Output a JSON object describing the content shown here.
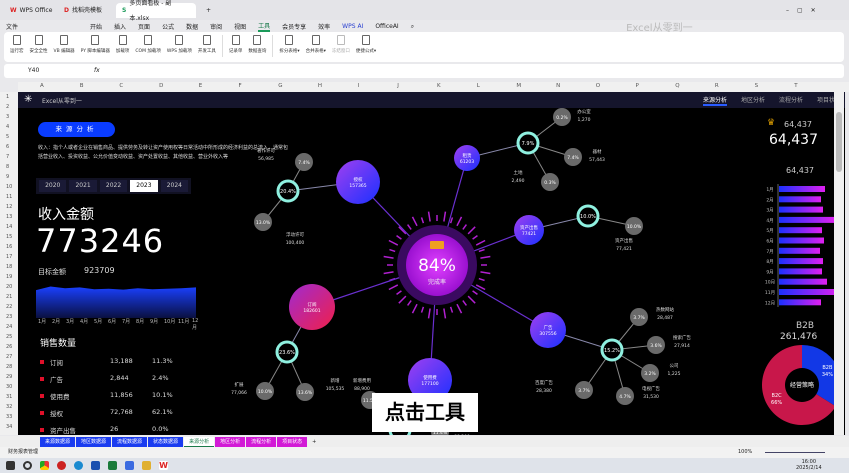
{
  "window": {
    "tabs": [
      "WPS Office",
      "找稻壳模板",
      "多页面看板 - 副本.xlsx"
    ],
    "brand_watermark": "Excel从零到一",
    "user_badge": "会"
  },
  "menu": [
    "文件",
    "开始",
    "插入",
    "页面",
    "公式",
    "数据",
    "审阅",
    "视图",
    "工具",
    "会员专享",
    "效率",
    "WPS AI",
    "OfficeAI"
  ],
  "ribbon": [
    "运行宏",
    "安全全性",
    "VB 编辑器",
    "PY 脚本编辑器",
    "加载项",
    "COM 加载项",
    "WPS 加载项",
    "开发工具",
    "记录单",
    "数据查询",
    "拆分表格▾",
    "合并表格▾",
    "冻结窗口",
    "便捷公式▾"
  ],
  "formula_bar": {
    "cell_ref": "Y40",
    "fx": "fx",
    "value": ""
  },
  "columns": [
    "A",
    "B",
    "C",
    "D",
    "E",
    "F",
    "G",
    "H",
    "I",
    "J",
    "K",
    "L",
    "M",
    "N",
    "O",
    "P",
    "Q",
    "R",
    "S",
    "T"
  ],
  "rows": [
    "1",
    "2",
    "3",
    "4",
    "5",
    "6",
    "7",
    "8",
    "9",
    "10",
    "11",
    "12",
    "13",
    "14",
    "15",
    "16",
    "17",
    "18",
    "19",
    "20",
    "21",
    "22",
    "23",
    "24",
    "25",
    "26",
    "27",
    "28",
    "29",
    "30",
    "31",
    "32",
    "33",
    "34"
  ],
  "dashboard": {
    "brand": "Excel从零到一",
    "nav": [
      "来源分析",
      "地区分析",
      "流程分析",
      "项目状态"
    ],
    "section_pill": "来源分析",
    "description": "收入：指个人或者企业在销售商品、提供劳务及转让资产使用权等日常活动中所形成的经济利益的总流入，通常包括营业收入、投资收益、公允价值变动收益、资产处置收益、其他收益、营业外收入等",
    "years": [
      "2020",
      "2021",
      "2022",
      "2023",
      "2024"
    ],
    "selected_year": "2023",
    "revenue_label": "收入金额",
    "revenue_value": "773246",
    "target_label": "目标金额",
    "target_value": "923709",
    "months": [
      "1月",
      "2月",
      "3月",
      "4月",
      "5月",
      "6月",
      "7月",
      "8月",
      "9月",
      "10月",
      "11月",
      "12月"
    ],
    "area_values": [
      62,
      70,
      66,
      68,
      64,
      65,
      63,
      66,
      64,
      65,
      66,
      68
    ],
    "sales_title": "销售数量",
    "sales": [
      [
        "订阅",
        "13,188",
        "11.3%"
      ],
      [
        "广告",
        "2,844",
        "2.4%"
      ],
      [
        "使用费",
        "11,856",
        "10.1%"
      ],
      [
        "授权",
        "72,768",
        "62.1%"
      ],
      [
        "资产出售",
        "26",
        "0.0%"
      ]
    ],
    "center": {
      "value": "84%",
      "label": "完成率"
    },
    "hubs": [
      {
        "name": "授权",
        "value": "157365",
        "ring": "20.4%",
        "leaves": [
          [
            "著作许可",
            "56,985",
            "7.4%"
          ],
          [
            "浮动许可",
            "100,400",
            "13.0%"
          ]
        ]
      },
      {
        "name": "租赁",
        "value": "61203",
        "ring": "7.9%",
        "leaves": [
          [
            "办公室",
            "1,270",
            "0.2%"
          ],
          [
            "器材",
            "57,443",
            "7.4%"
          ],
          [
            "土地",
            "2,490",
            "0.3%"
          ]
        ]
      },
      {
        "name": "资产出售",
        "value": "77421",
        "ring": "10.0%",
        "leaves": [
          [
            "资产出售",
            "77,421",
            "10.0%"
          ]
        ]
      },
      {
        "name": "订阅",
        "value": "182601",
        "ring": "23.6%",
        "leaves": [
          [
            "扩展",
            "77,066",
            "10.0%"
          ],
          [
            "新增",
            "105,535",
            "13.6%"
          ]
        ]
      },
      {
        "name": "使用费",
        "value": "177100",
        "ring": "22.0%",
        "leaves": [
          [
            "新增费用",
            "88,900",
            "11.5%"
          ],
          [
            "",
            "88,200",
            "11.4%"
          ]
        ]
      },
      {
        "name": "广告",
        "value": "307556",
        "ring": "15.2%",
        "leaves": [
          [
            "热数网站",
            "28,487",
            "3.7%"
          ],
          [
            "搜索广告",
            "27,914",
            "3.6%"
          ],
          [
            "公司",
            "1,225",
            "3.2%"
          ],
          [
            "电视广告",
            "31,530",
            "4.7%"
          ],
          [
            "百度广告",
            "28,380",
            "3.7%"
          ]
        ]
      }
    ],
    "kpi_small": "64,437",
    "kpi_big": "64,437",
    "bar_title": "64,437",
    "bar_values": [
      46,
      42,
      44,
      56,
      43,
      45,
      41,
      44,
      43,
      48,
      60,
      42
    ],
    "donut": {
      "title": "B2B",
      "value": "261,476",
      "center": "经营策略",
      "slices": [
        {
          "name": "B2B",
          "pct": 34,
          "label": "34%",
          "color": "#1238e6"
        },
        {
          "name": "B2C",
          "pct": 66,
          "label": "66%",
          "color": "#c8174a"
        }
      ]
    },
    "caption": "点击工具"
  },
  "sheet_tabs": [
    "来源数据源",
    "地区数据源",
    "流程数据源",
    "状态数据源",
    "来源分析",
    "地区分析",
    "流程分析",
    "项目状态"
  ],
  "active_sheet": "来源分析",
  "status": {
    "workbook": "财务报表管理",
    "zoom": "100%"
  },
  "clock": {
    "time": "16:00",
    "date": "2025/2/14"
  }
}
